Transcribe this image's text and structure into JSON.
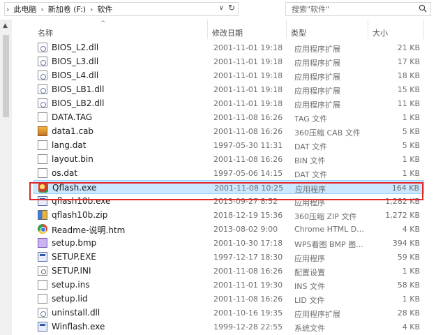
{
  "address": {
    "crumbs": [
      "此电脑",
      "新加卷 (F:)",
      "软件"
    ],
    "dropdown_icon": "chevron-down",
    "refresh_icon": "refresh"
  },
  "search": {
    "placeholder": "搜索\"软件\"",
    "icon": "search"
  },
  "columns": {
    "name": "名称",
    "date": "修改日期",
    "type": "类型",
    "size": "大小"
  },
  "files": [
    {
      "name": "BIOS_L2.dll",
      "date": "2001-11-01 19:18",
      "type": "应用程序扩展",
      "size": "21 KB",
      "icon": "dll"
    },
    {
      "name": "BIOS_L3.dll",
      "date": "2001-11-01 19:18",
      "type": "应用程序扩展",
      "size": "17 KB",
      "icon": "dll"
    },
    {
      "name": "BIOS_L4.dll",
      "date": "2001-11-01 19:18",
      "type": "应用程序扩展",
      "size": "18 KB",
      "icon": "dll"
    },
    {
      "name": "BIOS_LB1.dll",
      "date": "2001-11-01 19:18",
      "type": "应用程序扩展",
      "size": "15 KB",
      "icon": "dll"
    },
    {
      "name": "BIOS_LB2.dll",
      "date": "2001-11-01 19:18",
      "type": "应用程序扩展",
      "size": "11 KB",
      "icon": "dll"
    },
    {
      "name": "DATA.TAG",
      "date": "2001-11-08 16:26",
      "type": "TAG 文件",
      "size": "1 KB",
      "icon": "doc"
    },
    {
      "name": "data1.cab",
      "date": "2001-11-08 16:26",
      "type": "360压缩 CAB 文件",
      "size": "5 KB",
      "icon": "cab"
    },
    {
      "name": "lang.dat",
      "date": "1997-05-30 11:31",
      "type": "DAT 文件",
      "size": "5 KB",
      "icon": "doc"
    },
    {
      "name": "layout.bin",
      "date": "2001-11-08 16:26",
      "type": "BIN 文件",
      "size": "1 KB",
      "icon": "doc"
    },
    {
      "name": "os.dat",
      "date": "1997-05-06 14:15",
      "type": "DAT 文件",
      "size": "1 KB",
      "icon": "doc"
    },
    {
      "name": "Qflash.exe",
      "date": "2001-11-08 10:25",
      "type": "应用程序",
      "size": "164 KB",
      "icon": "qexe",
      "selected": true
    },
    {
      "name": "qflash10b.exe",
      "date": "2013-09-27 8:52",
      "type": "应用程序",
      "size": "1,282 KB",
      "icon": "exe"
    },
    {
      "name": "qflash10b.zip",
      "date": "2018-12-19 15:36",
      "type": "360压缩 ZIP 文件",
      "size": "1,272 KB",
      "icon": "zip"
    },
    {
      "name": "Readme-说明.htm",
      "date": "2013-08-02 9:00",
      "type": "Chrome HTML D...",
      "size": "4 KB",
      "icon": "chrome"
    },
    {
      "name": "setup.bmp",
      "date": "2001-10-30 17:18",
      "type": "WPS看图 BMP 图...",
      "size": "394 KB",
      "icon": "bmp"
    },
    {
      "name": "SETUP.EXE",
      "date": "1997-12-17 18:30",
      "type": "应用程序",
      "size": "59 KB",
      "icon": "exe"
    },
    {
      "name": "SETUP.INI",
      "date": "2001-11-08 16:26",
      "type": "配置设置",
      "size": "1 KB",
      "icon": "ini"
    },
    {
      "name": "setup.ins",
      "date": "2001-11-01 19:30",
      "type": "INS 文件",
      "size": "58 KB",
      "icon": "doc"
    },
    {
      "name": "setup.lid",
      "date": "2001-11-08 16:26",
      "type": "LID 文件",
      "size": "1 KB",
      "icon": "doc"
    },
    {
      "name": "uninstall.dll",
      "date": "2001-10-16 19:35",
      "type": "应用程序扩展",
      "size": "28 KB",
      "icon": "dll"
    },
    {
      "name": "Winflash.exe",
      "date": "1999-12-28 22:55",
      "type": "系统文件",
      "size": "4 KB",
      "icon": "exe"
    }
  ],
  "highlight_color": "#e0272b",
  "selection_color": "#cce8ff"
}
